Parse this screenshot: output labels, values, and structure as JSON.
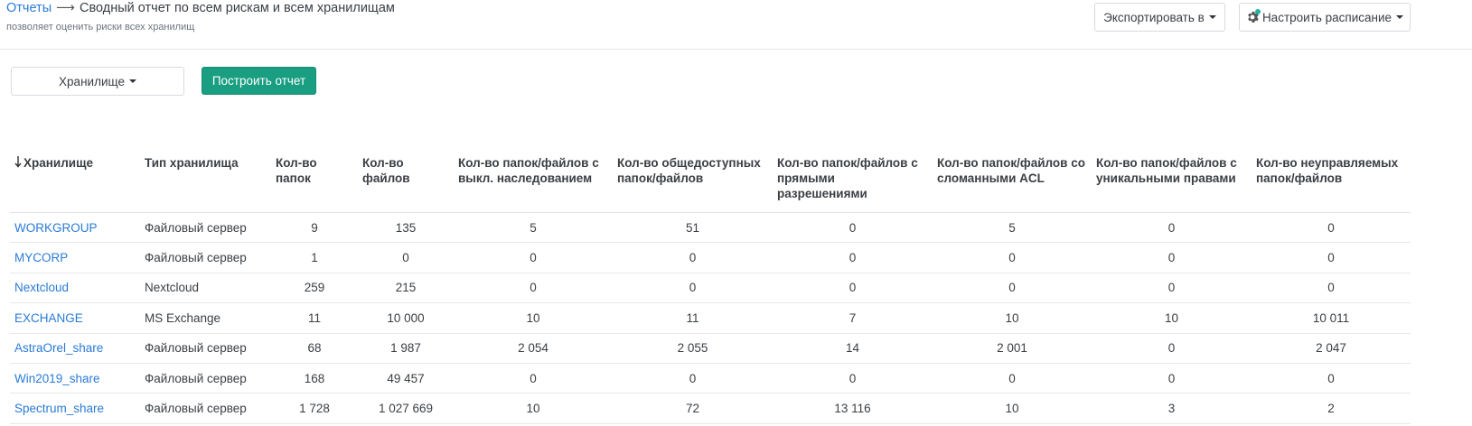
{
  "header": {
    "breadcrumb_link": "Отчеты",
    "arrow": "⟶",
    "title": "Сводный отчет по всем рискам и всем хранилищам",
    "subtitle": "позволяет оценить риски всех хранилищ",
    "export_label": "Экспортировать в",
    "schedule_label": "Настроить расписание"
  },
  "filters": {
    "storage_label": "Хранилище",
    "build_label": "Построить отчет"
  },
  "table": {
    "columns": [
      "Хранилище",
      "Тип хранилища",
      "Кол-во папок",
      "Кол-во файлов",
      "Кол-во папок/файлов с выкл. наследованием",
      "Кол-во общедоступных папок/файлов",
      "Кол-во папок/файлов с прямыми разрешениями",
      "Кол-во папок/файлов со сломанными ACL",
      "Кол-во папок/файлов с уникальными правами",
      "Кол-во неуправляемых папок/файлов"
    ],
    "sort_icon": "sort-down-arrow-icon",
    "rows": [
      [
        "WORKGROUP",
        "Файловый сервер",
        "9",
        "135",
        "5",
        "51",
        "0",
        "5",
        "0",
        "0"
      ],
      [
        "MYCORP",
        "Файловый сервер",
        "1",
        "0",
        "0",
        "0",
        "0",
        "0",
        "0",
        "0"
      ],
      [
        "Nextcloud",
        "Nextcloud",
        "259",
        "215",
        "0",
        "0",
        "0",
        "0",
        "0",
        "0"
      ],
      [
        "EXCHANGE",
        "MS Exchange",
        "11",
        "10 000",
        "10",
        "11",
        "7",
        "10",
        "10",
        "10 011"
      ],
      [
        "AstraOrel_share",
        "Файловый сервер",
        "68",
        "1 987",
        "2 054",
        "2 055",
        "14",
        "2 001",
        "0",
        "2 047"
      ],
      [
        "Win2019_share",
        "Файловый сервер",
        "168",
        "49 457",
        "0",
        "0",
        "0",
        "0",
        "0",
        "0"
      ],
      [
        "Spectrum_share",
        "Файловый сервер",
        "1 728",
        "1 027 669",
        "10",
        "72",
        "13 116",
        "10",
        "3",
        "2"
      ]
    ]
  },
  "colors": {
    "link": "#2a7bd6",
    "primary_button": "#1a9e82",
    "gear_badge": "#20b3a0"
  }
}
